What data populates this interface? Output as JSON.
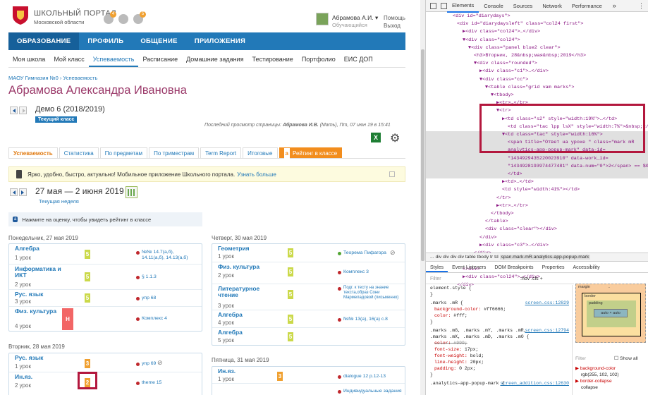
{
  "header": {
    "brand_line1": "ШКОЛЬНЫЙ ПОРТАЛ",
    "brand_line2": "Московской области",
    "badge1": "4",
    "badge2": "5",
    "user_name": "Абрамова А.И.",
    "user_role": "Обучающийся",
    "help": "Помощь",
    "logout": "Выход"
  },
  "mainnav": [
    "ОБРАЗОВАНИЕ",
    "ПРОФИЛЬ",
    "ОБЩЕНИЕ",
    "ПРИЛОЖЕНИЯ"
  ],
  "subnav": [
    "Моя школа",
    "Мой класс",
    "Успеваемость",
    "Расписание",
    "Домашние задания",
    "Тестирование",
    "Портфолио",
    "ЕИС ДОП"
  ],
  "breadcrumb": "МАОУ Гимназия №0 › Успеваемость",
  "page_title": "Абрамова Александра Ивановна",
  "year": {
    "label": "Демо 6 (2018/2019)",
    "badge": "Текущий класс"
  },
  "last_view": {
    "prefix": "Последний просмотр страницы:",
    "name": "Абрамова И.В.",
    "suffix": "(Мать), Пт, 07 июн 19 в 15:41"
  },
  "export_icon_label": "X",
  "tabs": [
    "Успеваемость",
    "Статистика",
    "По предметам",
    "По триместрам",
    "Term Report",
    "Итоговые",
    "Рейтинг в классе"
  ],
  "rating_icon": "a",
  "promo": {
    "text": "Ярко, удобно, быстро, актуально! Мобильное приложение Школьного портала.",
    "link": "Узнать больше"
  },
  "week": {
    "range": "27 мая — 2 июня 2019",
    "label": "Текущая неделя"
  },
  "hint": {
    "icon": "a",
    "text": "Нажмите на оценку, чтобы увидеть рейтинг в классе"
  },
  "days": {
    "mon": {
      "title": "Понедельник, 27 мая 2019",
      "rows": [
        {
          "subject": "Алгебра",
          "count": "1 урок",
          "mark": "5",
          "hw": "№№ 14.7(а,б), 14.11(а,б), 14.13(а,б)"
        },
        {
          "subject": "Информатика и ИКТ",
          "count": "2 урок",
          "mark": "5",
          "hw": "§ 1.1.3"
        },
        {
          "subject": "Рус. язык",
          "count": "3 урок",
          "mark": "5",
          "hw": "упр 68"
        },
        {
          "subject": "Физ. культура",
          "count": "4 урок",
          "mark": "Н",
          "hw": "Комплекс 4"
        }
      ]
    },
    "tue": {
      "title": "Вторник, 28 мая 2019",
      "rows": [
        {
          "subject": "Рус. язык",
          "count": "1 урок",
          "mark": "3",
          "hw": "упр 69"
        },
        {
          "subject": "Ин.яз.",
          "count": "2 урок",
          "mark": "2",
          "hw": "theme 15"
        }
      ]
    },
    "thu": {
      "title": "Четверг, 30 мая 2019",
      "rows": [
        {
          "subject": "Геометрия",
          "count": "1 урок",
          "mark": "5",
          "hw": "Теорема Пифагора"
        },
        {
          "subject": "Физ. культура",
          "count": "2 урок",
          "mark": "5",
          "hw": "Комплекс 3"
        },
        {
          "subject": "Литературное чтение",
          "count": "3 урок",
          "mark": "5",
          "hw": "Подг. к тесту на знание текста,образ Сони Мармеладовой (письменно)"
        },
        {
          "subject": "Алгебра",
          "count": "4 урок",
          "mark": "5",
          "hw": "№№ 13(а), 16(а) с.8"
        },
        {
          "subject": "Алгебра",
          "count": "5 урок",
          "mark": "5",
          "hw": ""
        }
      ]
    },
    "fri": {
      "title": "Пятница, 31 мая 2019",
      "rows": [
        {
          "subject": "Ин.яз.",
          "count": "1 урок",
          "mark": "3",
          "hw": "dialogue 12 p.12-13"
        },
        {
          "subject": "",
          "count": "",
          "mark": "",
          "hw": "Индивидуальные задания"
        }
      ]
    }
  },
  "devtools": {
    "tabs": [
      "Elements",
      "Console",
      "Sources",
      "Network",
      "Performance"
    ],
    "more": "»",
    "dom_lines": [
      "<div id=\"diarydays\">",
      "<div id=\"diarydaysleft\" class=\"col24 first\">",
      "▶<div class=\"col24\">…</div>",
      "▼<div class=\"col24\">",
      "▼<div class=\"panel blue2 clear\">",
      "<h3>Вторник, 28&nbsp;мая&nbsp;2019</h3>",
      "▼<div class=\"rounded\">",
      "▶<div class=\"c1\">…</div>",
      "▼<div class=\"cc\">",
      "▼<table class=\"grid vam marks\">",
      "▼<tbody>",
      "▶<tr>…</tr>",
      "▼<tr>",
      "▶<td class=\"s2\" style=\"width:19%\">…</td>",
      "<td class=\"tac lpp lsX\" style=\"width:7%\">&nbsp;</td>",
      "▼<td class=\"tac\" style=\"width:16%\">",
      "<span title=\"Ответ на уроке \" class=\"mark mR",
      "analytics-app-popup-mark\" data-id=",
      "\"1434929435220023910\" data-work_id=",
      "\"1434928193974477481\" data-num=\"0\">2</span> == $0",
      "</td>",
      "▶<td>…</td>",
      "<td style=\"width:41%\"></td>",
      "</tr>",
      "▶<tr>…</tr>",
      "</tbody>",
      "</table>",
      "<div class=\"clear\"></div>",
      "</div>",
      "▶<div class=\"c3\">…</div>",
      "</div>",
      "</div>",
      "</div>",
      "▶<div class=\"col24\">…</div>",
      "</div>"
    ],
    "breadcrumbs": [
      "...",
      "div",
      "div",
      "div",
      "div",
      "table",
      "tbody",
      "tr",
      "td",
      "span.mark.mR.analytics-app-popup-mark"
    ],
    "style_tabs": [
      "Styles",
      "Event Listeners",
      "DOM Breakpoints",
      "Properties",
      "Accessibility"
    ],
    "filter_placeholder": "Filter",
    "filter_opts": ":hov  .cls  +",
    "style_blocks": [
      {
        "selector": "element.style {",
        "src": "",
        "props": [
          "}"
        ]
      },
      {
        "selector": ".marks .mR {",
        "src": "screen.css:12829",
        "props": [
          "background-color: #ff6666;",
          "color: #fff;",
          "}"
        ]
      },
      {
        "selector": ".marks .mG, .marks .mY, .marks .mR, .marks .mX, .marks .mD, .marks .mO {",
        "src": "screen.css:12794",
        "props": [
          "color: #999;",
          "font-size: 17px;",
          "font-weight: bold;",
          "line-height: 20px;",
          "padding: 0 2px;",
          "}"
        ]
      },
      {
        "selector": ".analytics-app-popup-mark {",
        "src": "screen_addition.css:12630",
        "props": []
      }
    ],
    "boxmodel": {
      "margin": "margin",
      "border": "border",
      "padding": "padding",
      "content": "auto × auto",
      "dash": "-"
    },
    "right_filter": "Filter",
    "show_all": "Show all",
    "computed": [
      {
        "prop": "background-color",
        "val": "rgb(255, 102, 102)"
      },
      {
        "prop": "border-collapse",
        "val": "collapse"
      }
    ]
  }
}
